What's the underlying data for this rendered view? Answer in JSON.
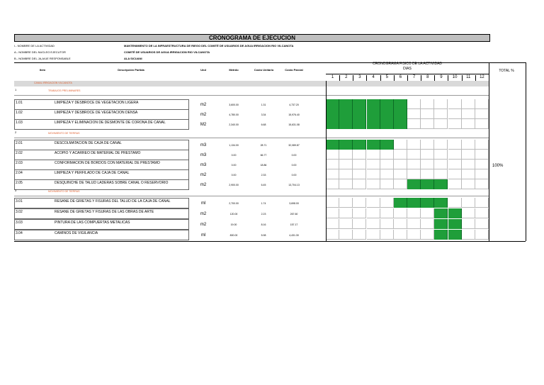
{
  "title": "CRONOGRAMA DE EJECUCION",
  "info": [
    {
      "label": "I.- NOMBRE DE LA ACTIVIDAD",
      "value": "MANTENIMIENTO DE LA INFRAESTRUCTURA DE RIEGO DEL COMITÉ DE USUARIOS DE AGUA IRRIGACION RIO VILCANOTA"
    },
    {
      "label": "A.- NOMBRE DEL NUCLEO EJECUTOR",
      "value": "COMITÉ DE USUARIOS DE AGUA IRRIGACION RIO VILCANOTA"
    },
    {
      "label": "B.- NOMBRE DEL JA,A/UE RESPONSABLE",
      "value": "ALA SICUANI"
    }
  ],
  "headers": {
    "item": "Item",
    "descripcion": "Descripción Partida",
    "und": "Und",
    "metrado": "Metrdo",
    "costo_unitario": "Costo Unitario",
    "costo_parcial": "Costo Parcial",
    "cronograma": "CRONOGRAMA FISICO DE LA ACTIVIDAD",
    "dias": "DIAS",
    "total": "TOTAL %"
  },
  "days": [
    "1",
    "2",
    "3",
    "4",
    "5",
    "6",
    "7",
    "8",
    "9",
    "10",
    "11",
    "12"
  ],
  "section_label": "CANAL IRRIGACION VILCANOTA",
  "groups": [
    {
      "num": "1",
      "name": "TRABAJOS PRELIMINARES"
    },
    {
      "num": "2",
      "name": "MOVIMIENTO DE TIERRAS"
    },
    {
      "num": "3",
      "name": "MOVIMIENTO DE TIERRAS"
    }
  ],
  "rows": [
    {
      "item": "1.01",
      "desc": "LIMPIEZA Y DESBROCE DE VEGETACION LIGERA",
      "und": "m2",
      "metrado": "3,600.00",
      "cu": "1.31",
      "cp": "4,737.20"
    },
    {
      "item": "1.02",
      "desc": "LIMPIEZA Y DESBROCE DE VEGETACION DENSA",
      "und": "m2",
      "metrado": "4,780.00",
      "cu": "3.34",
      "cp": "15,976.40"
    },
    {
      "item": "1.03",
      "desc": "LIMPIEZA Y ELIMINACION DE DESMONTE DE CORONA DE CANAL",
      "und": "M2",
      "metrado": "2,340.00",
      "cu": "6.68",
      "cp": "15,631.08"
    },
    {
      "item": "2.01",
      "desc": "DESCOLMATACION DE CAJA DE CANAL",
      "und": "m3",
      "metrado": "1,134.00",
      "cu": "28.71",
      "cp": "32,089.87"
    },
    {
      "item": "2.02",
      "desc": "ACOPIO Y ACARREO DE MATERIAL DE PRESTAMO",
      "und": "m3",
      "metrado": "0.00",
      "cu": "66.77",
      "cp": "0.00"
    },
    {
      "item": "2.03",
      "desc": "CONFORMACION DE BORDOS CON MATERIAL DE PRESTAMO",
      "und": "m3",
      "metrado": "0.00",
      "cu": "18.86",
      "cp": "0.00"
    },
    {
      "item": "2.04",
      "desc": "LIMPIEZA Y PERFILADO DE CAJA DE CANAL",
      "und": "m2",
      "metrado": "0.00",
      "cu": "2.33",
      "cp": "0.00"
    },
    {
      "item": "2.05",
      "desc": "DESQUINCHE DE TALUD LADERAS SOBRE CANAL O RESERVORIO",
      "und": "m2",
      "metrado": "2,900.00",
      "cu": "6.45",
      "cp": "13,704.13"
    },
    {
      "item": "3.01",
      "desc": "RESANE DE GRIETAS Y FISURAS DEL TALUD DE LA CAJA DE CANAL",
      "und": "ml",
      "metrado": "2,700.00",
      "cu": "1.74",
      "cp": "3,698.00"
    },
    {
      "item": "3.02",
      "desc": "RESANE DE GRIETAS Y FISURAS DE LAS OBRAS DE ARTE",
      "und": "m2",
      "metrado": "120.00",
      "cu": "2.23",
      "cp": "267.60"
    },
    {
      "item": "3.03",
      "desc": "PINTURA DE LAS COMPUERTAS METALICAS",
      "und": "m2",
      "metrado": "19.00",
      "cu": "8.16",
      "cp": "157.17"
    },
    {
      "item": "3.04",
      "desc": "CAMINOS DE VIGILANCIA",
      "und": "ml",
      "metrado": "800.00",
      "cu": "5.98",
      "cp": "4,431.30"
    }
  ],
  "total_pct": "100%",
  "colors": {
    "green": "#1f9e3a",
    "band": "#d9d9d9",
    "title_bg": "#bfbfbf",
    "subtitle": "#e06030"
  }
}
